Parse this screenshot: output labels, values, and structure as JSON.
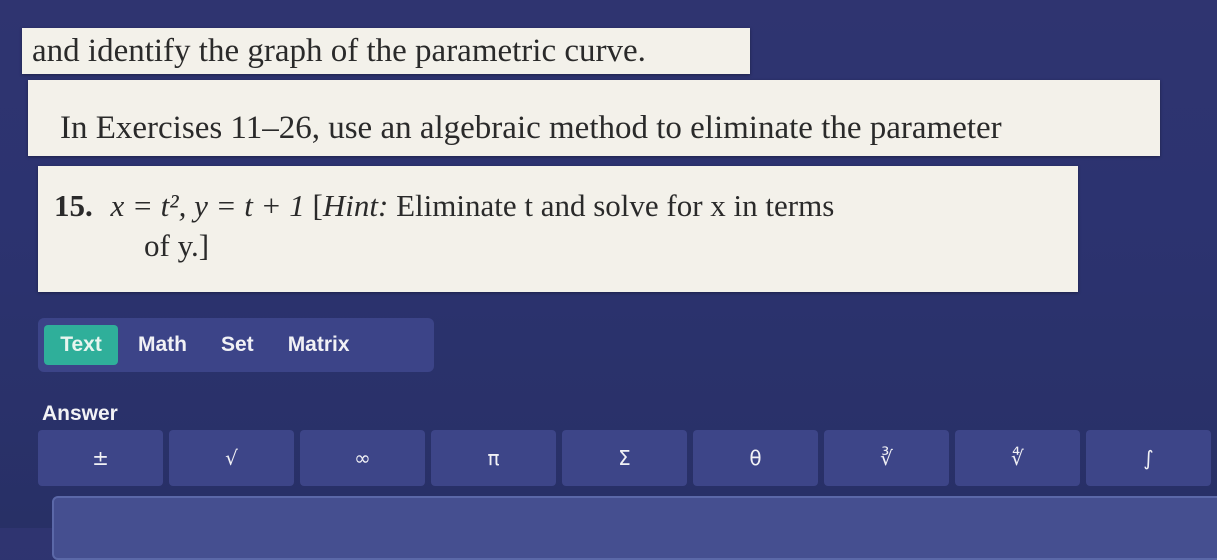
{
  "problem": {
    "line_top": "and identify the graph of the parametric curve.",
    "instructions": "In Exercises 11–26, use an algebraic method to eliminate the parameter",
    "exercise_number": "15.",
    "equation": "x = t², y = t + 1",
    "hint_label": "Hint:",
    "hint_text": "Eliminate t and solve for x in terms",
    "hint_line2": "of y.]"
  },
  "tabs": [
    {
      "label": "Text",
      "active": true
    },
    {
      "label": "Math",
      "active": false
    },
    {
      "label": "Set",
      "active": false
    },
    {
      "label": "Matrix",
      "active": false
    }
  ],
  "answer": {
    "label": "Answer",
    "value": ""
  },
  "toolbar": [
    {
      "symbol": "±",
      "icon": "plus-minus-icon"
    },
    {
      "symbol": "√",
      "icon": "square-root-icon"
    },
    {
      "symbol": "∞",
      "icon": "infinity-icon"
    },
    {
      "symbol": "π",
      "icon": "pi-icon"
    },
    {
      "symbol": "Σ",
      "icon": "sigma-icon"
    },
    {
      "symbol": "θ",
      "icon": "theta-icon"
    },
    {
      "symbol": "∛",
      "icon": "cube-root-icon"
    },
    {
      "symbol": "∜",
      "icon": "nth-root-icon"
    },
    {
      "symbol": "∫",
      "icon": "integral-icon"
    }
  ],
  "colors": {
    "background": "#2f3470",
    "active_tab": "#2faf9a",
    "button": "#3d4588"
  }
}
